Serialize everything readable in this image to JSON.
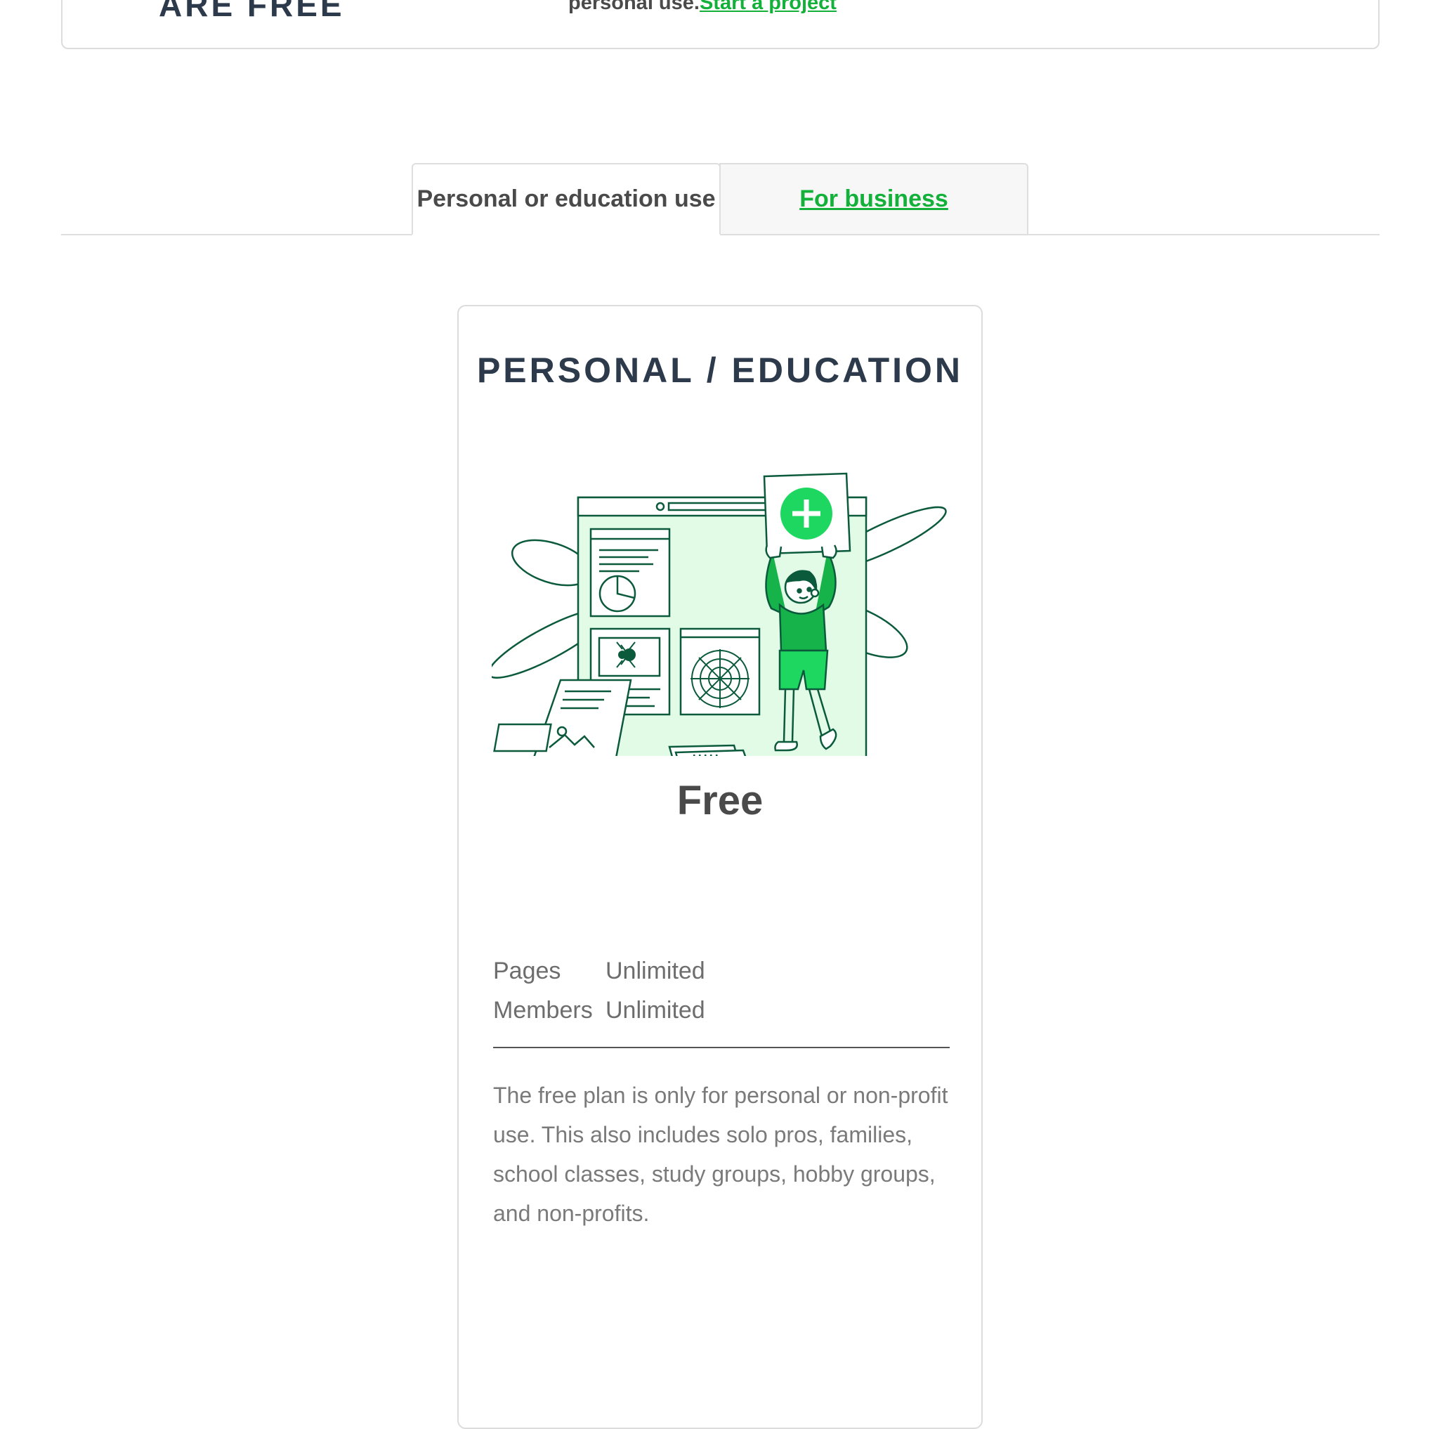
{
  "banner": {
    "heading": "ARE FREE",
    "text": "personal use.",
    "link": "Start a project"
  },
  "tabs": [
    {
      "label": "Personal or education use",
      "active": true
    },
    {
      "label": "For business",
      "active": false
    }
  ],
  "plan": {
    "title": "PERSONAL / EDUCATION",
    "illustration": "person-holding-plus-card-illustration",
    "price": "Free",
    "specs": [
      {
        "label": "Pages",
        "value": "Unlimited"
      },
      {
        "label": "Members",
        "value": "Unlimited"
      }
    ],
    "description": "The free plan is only for personal or non-profit use. This also includes solo pros, families, school classes, study groups, hobby groups, and non-profits."
  },
  "colors": {
    "accent_green": "#13b03a",
    "bright_green": "#1ed760",
    "outline_green": "#0b5a3c",
    "heading_navy": "#2c3a4b"
  }
}
